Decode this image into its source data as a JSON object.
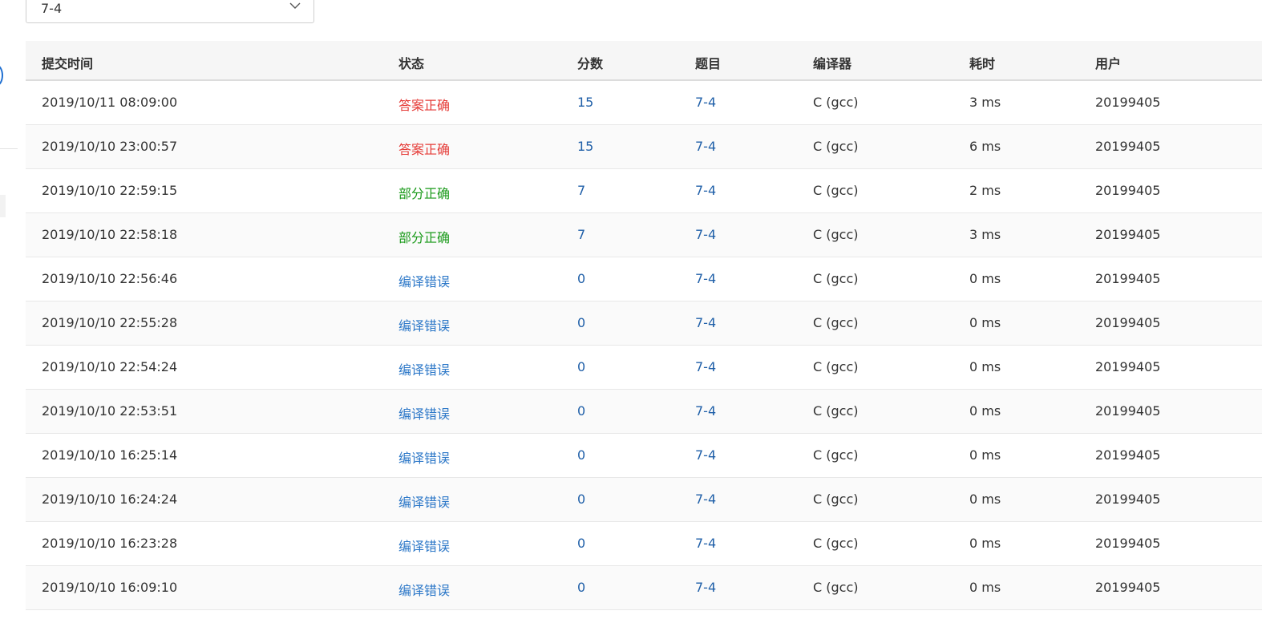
{
  "filter": {
    "problem_value": "7-4"
  },
  "table": {
    "headers": {
      "time": "提交时间",
      "status": "状态",
      "score": "分数",
      "problem": "题目",
      "compiler": "编译器",
      "duration": "耗时",
      "user": "用户"
    },
    "rows": [
      {
        "time": "2019/10/11 08:09:00",
        "status": "答案正确",
        "status_type": "ac",
        "score": "15",
        "problem": "7-4",
        "compiler": "C (gcc)",
        "duration": "3 ms",
        "user": "20199405"
      },
      {
        "time": "2019/10/10 23:00:57",
        "status": "答案正确",
        "status_type": "ac",
        "score": "15",
        "problem": "7-4",
        "compiler": "C (gcc)",
        "duration": "6 ms",
        "user": "20199405"
      },
      {
        "time": "2019/10/10 22:59:15",
        "status": "部分正确",
        "status_type": "pa",
        "score": "7",
        "problem": "7-4",
        "compiler": "C (gcc)",
        "duration": "2 ms",
        "user": "20199405"
      },
      {
        "time": "2019/10/10 22:58:18",
        "status": "部分正确",
        "status_type": "pa",
        "score": "7",
        "problem": "7-4",
        "compiler": "C (gcc)",
        "duration": "3 ms",
        "user": "20199405"
      },
      {
        "time": "2019/10/10 22:56:46",
        "status": "编译错误",
        "status_type": "ce",
        "score": "0",
        "problem": "7-4",
        "compiler": "C (gcc)",
        "duration": "0 ms",
        "user": "20199405"
      },
      {
        "time": "2019/10/10 22:55:28",
        "status": "编译错误",
        "status_type": "ce",
        "score": "0",
        "problem": "7-4",
        "compiler": "C (gcc)",
        "duration": "0 ms",
        "user": "20199405"
      },
      {
        "time": "2019/10/10 22:54:24",
        "status": "编译错误",
        "status_type": "ce",
        "score": "0",
        "problem": "7-4",
        "compiler": "C (gcc)",
        "duration": "0 ms",
        "user": "20199405"
      },
      {
        "time": "2019/10/10 22:53:51",
        "status": "编译错误",
        "status_type": "ce",
        "score": "0",
        "problem": "7-4",
        "compiler": "C (gcc)",
        "duration": "0 ms",
        "user": "20199405"
      },
      {
        "time": "2019/10/10 16:25:14",
        "status": "编译错误",
        "status_type": "ce",
        "score": "0",
        "problem": "7-4",
        "compiler": "C (gcc)",
        "duration": "0 ms",
        "user": "20199405"
      },
      {
        "time": "2019/10/10 16:24:24",
        "status": "编译错误",
        "status_type": "ce",
        "score": "0",
        "problem": "7-4",
        "compiler": "C (gcc)",
        "duration": "0 ms",
        "user": "20199405"
      },
      {
        "time": "2019/10/10 16:23:28",
        "status": "编译错误",
        "status_type": "ce",
        "score": "0",
        "problem": "7-4",
        "compiler": "C (gcc)",
        "duration": "0 ms",
        "user": "20199405"
      },
      {
        "time": "2019/10/10 16:09:10",
        "status": "编译错误",
        "status_type": "ce",
        "score": "0",
        "problem": "7-4",
        "compiler": "C (gcc)",
        "duration": "0 ms",
        "user": "20199405"
      }
    ]
  },
  "colors": {
    "status_ac": "#e53935",
    "status_pa": "#1a9a1a",
    "status_ce": "#2d78c8",
    "link": "#1f5fa8"
  },
  "icons": {
    "select_chevron": "chevron-down-icon"
  }
}
